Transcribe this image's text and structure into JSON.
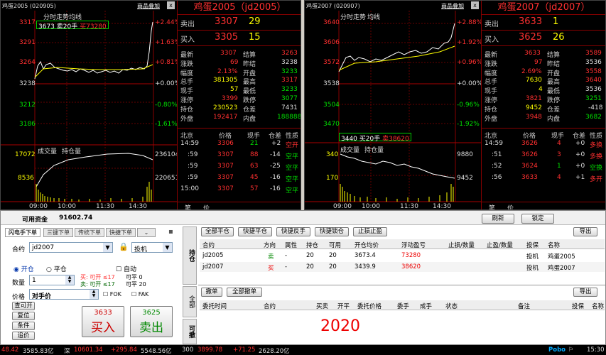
{
  "left": {
    "header": {
      "name": "鸡蛋2005",
      "code": "(020905)",
      "add_label": "商品叠加",
      "close": "x"
    },
    "title": "鸡蛋2005（jd2005）",
    "intraday_label": "分时走势",
    "avg_label": "均线",
    "overlay": {
      "a": "3673 卖20手",
      "b": "买73280"
    },
    "price_ticks": [
      "3317",
      "3291",
      "3264",
      "3238",
      "3212",
      "3186"
    ],
    "pct_ticks": [
      "+2.44%",
      "+1.63%",
      "+0.81%",
      "+0.00%",
      "-0.80%",
      "-1.61%"
    ],
    "vol_label": "成交量",
    "oi_label": "持仓量",
    "vol_ticks": [
      "17072",
      "8536"
    ],
    "oi_ticks": [
      "236104",
      "220651"
    ],
    "time_ticks": [
      "09:00",
      "10:00",
      "11:30",
      "14:30"
    ],
    "ask": {
      "label": "卖出",
      "price": "3307",
      "vol": "29"
    },
    "bid": {
      "label": "买入",
      "price": "3305",
      "vol": "15"
    },
    "stats": [
      [
        "最新",
        "3307",
        "结算",
        "3263"
      ],
      [
        "涨跌",
        "69",
        "昨结",
        "3238"
      ],
      [
        "幅度",
        "2.13%",
        "开盘",
        "3233"
      ],
      [
        "总手",
        "381305",
        "最高",
        "3317"
      ],
      [
        "现手",
        "57",
        "最低",
        "3233"
      ],
      [
        "涨停",
        "3399",
        "跌停",
        "3077"
      ],
      [
        "持仓",
        "230523",
        "仓差",
        "7431"
      ],
      [
        "外盘",
        "192417",
        "内盘",
        "188888"
      ]
    ],
    "ticks_header": [
      "北京",
      "价格",
      "现手",
      "仓差",
      "性质"
    ],
    "ticks": [
      [
        "14:59",
        "3306",
        "21",
        "+2",
        "空开"
      ],
      [
        ":59",
        "3307",
        "88",
        "-14",
        "空平"
      ],
      [
        ":59",
        "3307",
        "63",
        "-25",
        "空平"
      ],
      [
        ":59",
        "3307",
        "45",
        "-16",
        "空平"
      ],
      [
        "15:00",
        "3307",
        "57",
        "-16",
        "空平"
      ]
    ],
    "footer": [
      "笔",
      "价"
    ]
  },
  "right": {
    "header": {
      "name": "鸡蛋2007",
      "code": "(020907)",
      "add_label": "商品叠加",
      "close": "x"
    },
    "title": "鸡蛋2007（jd2007）",
    "intraday_label": "分时走势",
    "avg_label": "均线",
    "overlay": {
      "a": "3440 买20手",
      "b": "卖38620"
    },
    "price_ticks": [
      "3640",
      "3606",
      "3572",
      "3538",
      "3504",
      "3470"
    ],
    "pct_ticks": [
      "+2.88%",
      "+1.92%",
      "+0.96%",
      "+0.00%",
      "-0.96%",
      "-1.92%"
    ],
    "vol_label": "成交量",
    "oi_label": "持仓量",
    "vol_ticks": [
      "340",
      "170"
    ],
    "oi_ticks": [
      "9880",
      "9452"
    ],
    "time_ticks": [
      "09:00",
      "10:00",
      "11:30",
      "14:30"
    ],
    "ask": {
      "label": "卖出",
      "price": "3633",
      "vol": "1"
    },
    "bid": {
      "label": "买入",
      "price": "3625",
      "vol": "26"
    },
    "stats": [
      [
        "最新",
        "3633",
        "结算",
        "3589"
      ],
      [
        "涨跌",
        "97",
        "昨结",
        "3536"
      ],
      [
        "幅度",
        "2.69%",
        "开盘",
        "3558"
      ],
      [
        "总手",
        "7630",
        "最高",
        "3640"
      ],
      [
        "现手",
        "4",
        "最低",
        "3536"
      ],
      [
        "涨停",
        "3821",
        "跌停",
        "3251"
      ],
      [
        "持仓",
        "9452",
        "仓差",
        "-418"
      ],
      [
        "外盘",
        "3948",
        "内盘",
        "3682"
      ]
    ],
    "ticks_header": [
      "北京",
      "价格",
      "现手",
      "仓差",
      "性质"
    ],
    "ticks": [
      [
        "14:59",
        "3626",
        "4",
        "+0",
        "多换"
      ],
      [
        ":51",
        "3626",
        "3",
        "+0",
        "多换"
      ],
      [
        ":52",
        "3624",
        "1",
        "+0",
        "空换"
      ],
      [
        ":56",
        "3633",
        "4",
        "+1",
        "多开"
      ]
    ],
    "footer": [
      "笔",
      "价"
    ]
  },
  "order": {
    "funds_label": "可用资金",
    "funds_value": "91602.74",
    "refresh": "刷新",
    "lock": "锁定",
    "tabs": [
      "闪电手下单",
      "三键下单",
      "传统下单",
      "快捷下单"
    ],
    "contract_label": "合约",
    "contract_value": "jd2007",
    "hedge_value": "投机",
    "open_label": "开仓",
    "close_label": "平仓",
    "auto_label": "自动",
    "qty_label": "数量",
    "qty_value": "1",
    "limits": [
      "买: 可开 ≤17",
      "可平 0",
      "卖: 可开 ≤17",
      "可平 20"
    ],
    "price_label": "价格",
    "price_value": "对手价",
    "fok": "FOK",
    "fak": "FAK",
    "side_buttons": [
      "查可开",
      "复位",
      "条件",
      "追价"
    ],
    "buy": {
      "price": "3633",
      "label": "买入"
    },
    "sell": {
      "price": "3625",
      "label": "卖出"
    },
    "pos_tab": "持仓",
    "all_tab": "全部",
    "cxl_tab": "可撤",
    "pos_buttons": [
      "全部平仓",
      "快捷平仓",
      "快捷反手",
      "快捷锁仓",
      "止损止盈"
    ],
    "export": "导出",
    "pos_headers": [
      "合约",
      "方向",
      "属性",
      "持仓",
      "可用",
      "开仓均价",
      "浮动盈亏",
      "止损/数量",
      "止盈/数量",
      "投保",
      "名称"
    ],
    "positions": [
      [
        "jd2005",
        "卖",
        "-",
        "20",
        "20",
        "3673.4",
        "73280",
        "",
        "",
        "投机",
        "鸡蛋2005"
      ],
      [
        "jd2007",
        "买",
        "-",
        "20",
        "20",
        "3439.9",
        "38620",
        "",
        "",
        "投机",
        "鸡蛋2007"
      ]
    ],
    "cancel_buttons": [
      "撤单",
      "全部撤单"
    ],
    "ord_headers": [
      "委托时间",
      "合约",
      "买卖",
      "开平",
      "委托价格",
      "委手",
      "成手",
      "状态",
      "备注",
      "投保",
      "名称"
    ],
    "watermark": "2020"
  },
  "status": {
    "items": [
      "48.42",
      "3585.83亿",
      "深",
      "10601.34",
      "+295.84",
      "5548.56亿",
      "300",
      "3899.78",
      "+71.25",
      "2628.20亿"
    ],
    "brand": "Pobo",
    "time": "15:30"
  },
  "colors": {
    "up": "#ff3030",
    "down": "#00e000",
    "avg": "#ffff00",
    "price": "#ffffff",
    "vol": "#ffff00"
  }
}
